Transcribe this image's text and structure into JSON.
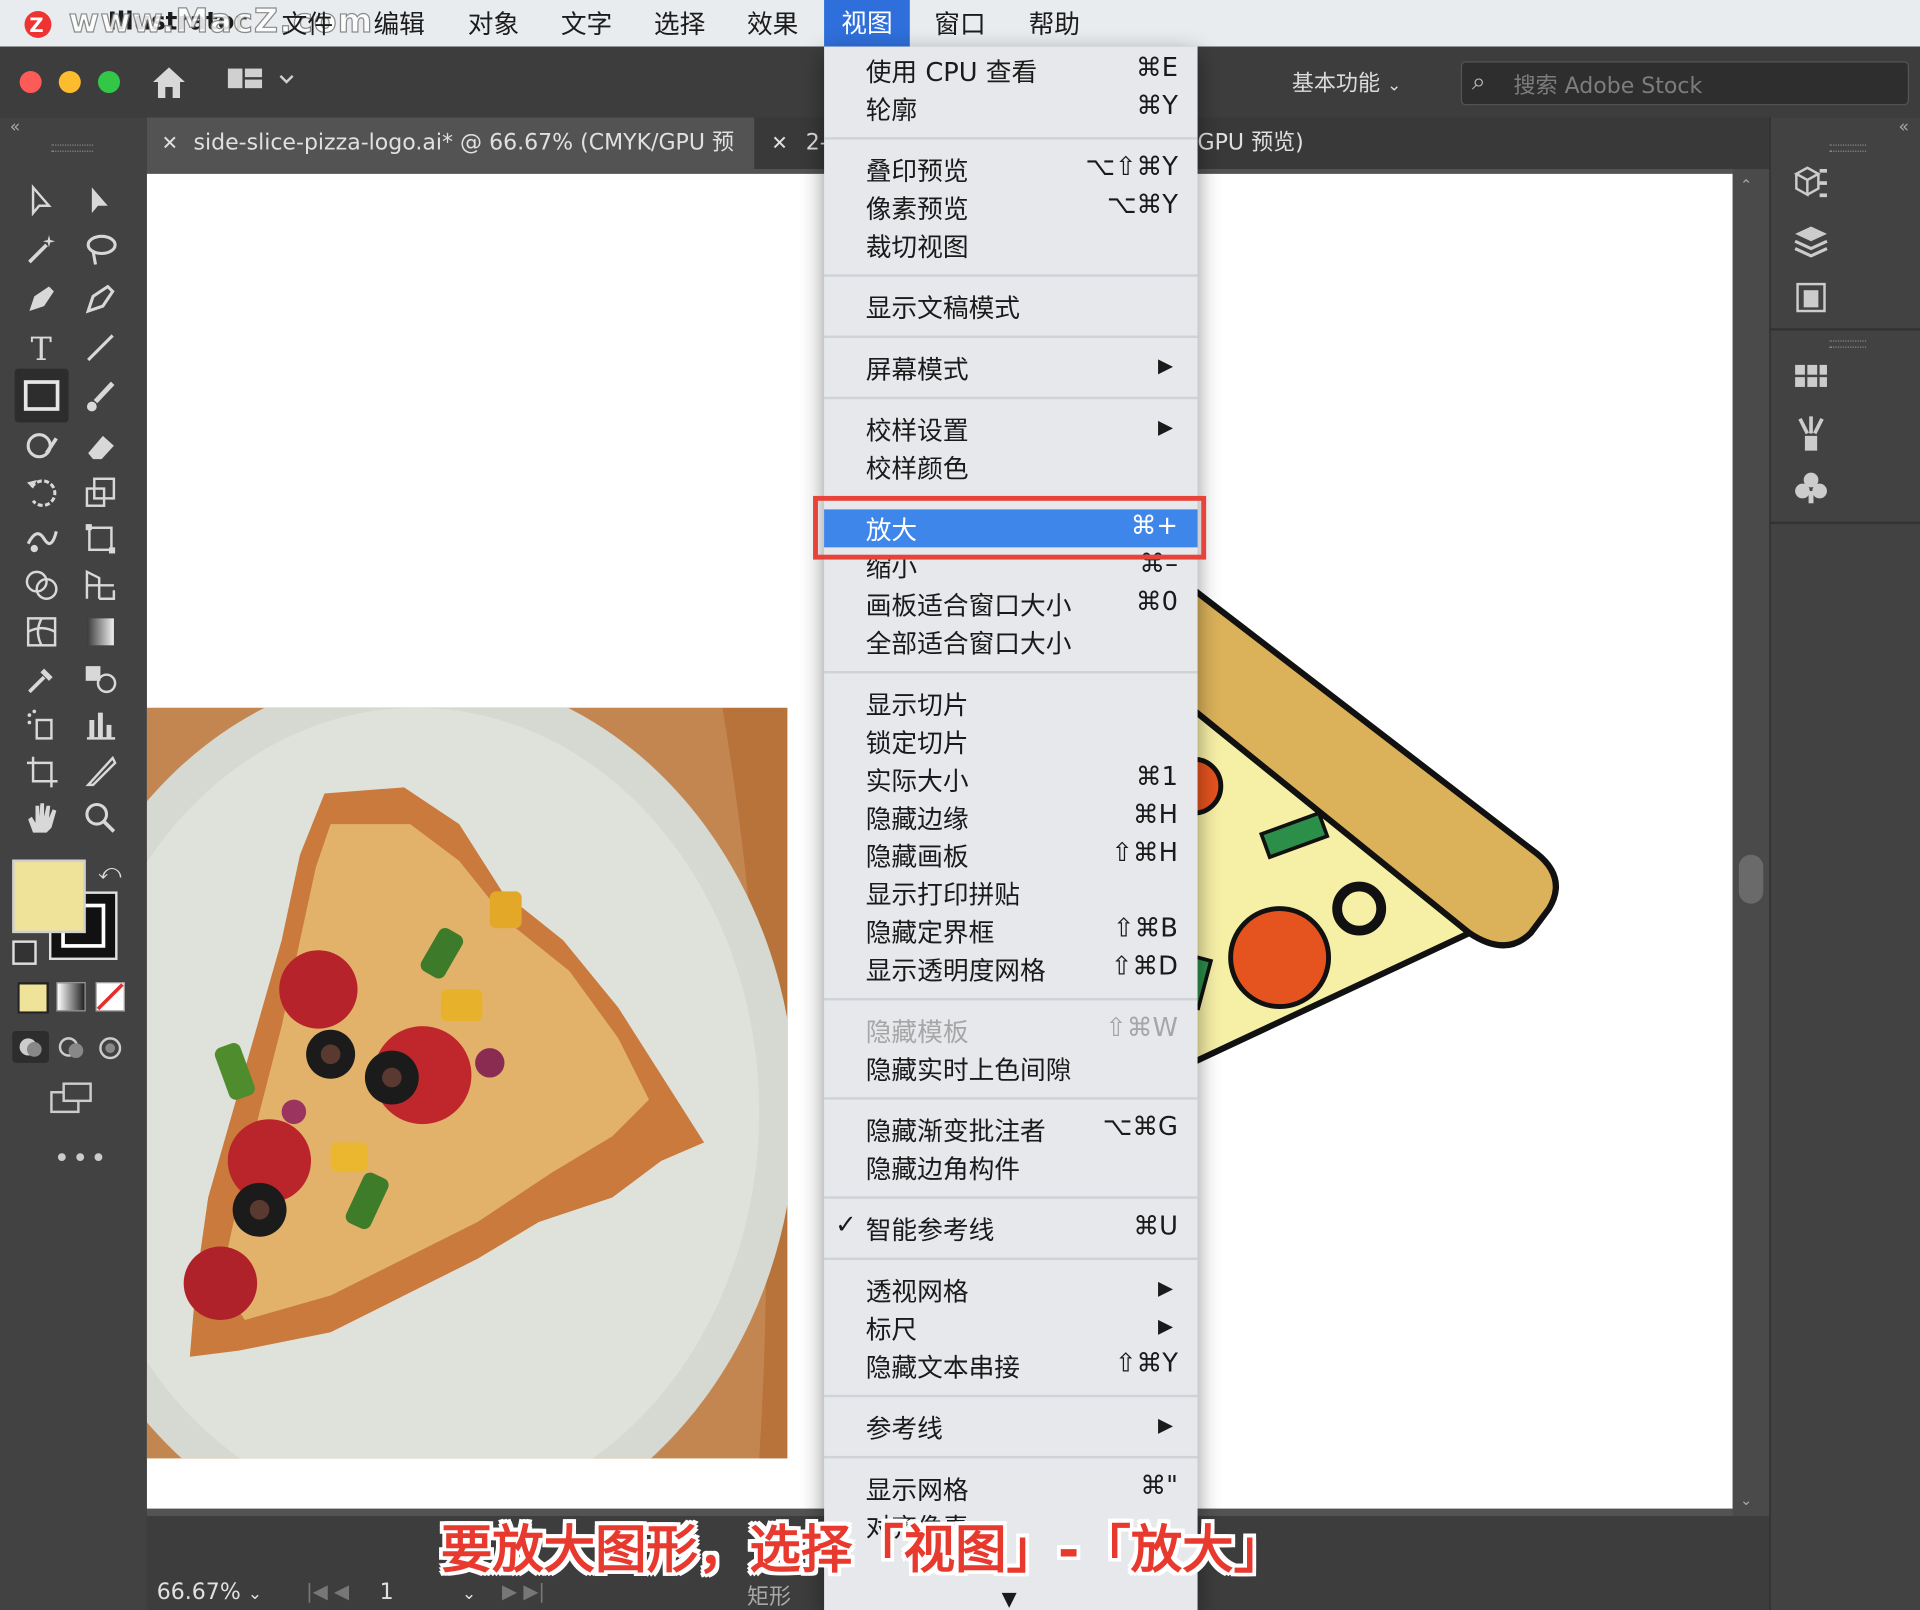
{
  "menubar": {
    "app": "Illustrator",
    "watermark": "www.MacZ.com",
    "items": [
      "文件",
      "编辑",
      "对象",
      "文字",
      "选择",
      "效果",
      "视图",
      "窗口",
      "帮助"
    ],
    "active_item": "视图"
  },
  "appbar": {
    "workspace": "基本功能",
    "search_placeholder": "搜索 Adobe Stock"
  },
  "tabs": [
    {
      "label": "side-slice-pizza-logo.ai* @ 66.67% (CMYK/GPU 预览)",
      "active": true
    },
    {
      "label": "2-",
      "active": false
    },
    {
      "label": "GPU 预览)",
      "active": false
    }
  ],
  "view_menu": {
    "items": [
      {
        "label": "使用 CPU 查看",
        "shortcut": "⌘E"
      },
      {
        "label": "轮廓",
        "shortcut": "⌘Y"
      },
      {
        "separator": true
      },
      {
        "label": "叠印预览",
        "shortcut": "⌥⇧⌘Y"
      },
      {
        "label": "像素预览",
        "shortcut": "⌥⌘Y"
      },
      {
        "label": "裁切视图",
        "shortcut": ""
      },
      {
        "separator": true
      },
      {
        "label": "显示文稿模式",
        "shortcut": ""
      },
      {
        "separator": true
      },
      {
        "label": "屏幕模式",
        "submenu": true
      },
      {
        "separator": true
      },
      {
        "label": "校样设置",
        "submenu": true
      },
      {
        "label": "校样颜色",
        "shortcut": ""
      },
      {
        "separator": true
      },
      {
        "label": "放大",
        "shortcut": "⌘+",
        "highlighted": true
      },
      {
        "label": "缩小",
        "shortcut": "⌘–"
      },
      {
        "label": "画板适合窗口大小",
        "shortcut": "⌘0"
      },
      {
        "label": "全部适合窗口大小",
        "shortcut": ""
      },
      {
        "separator": true
      },
      {
        "label": "显示切片",
        "shortcut": ""
      },
      {
        "label": "锁定切片",
        "shortcut": ""
      },
      {
        "label": "实际大小",
        "shortcut": "⌘1"
      },
      {
        "label": "隐藏边缘",
        "shortcut": "⌘H"
      },
      {
        "label": "隐藏画板",
        "shortcut": "⇧⌘H"
      },
      {
        "label": "显示打印拼贴",
        "shortcut": ""
      },
      {
        "label": "隐藏定界框",
        "shortcut": "⇧⌘B"
      },
      {
        "label": "显示透明度网格",
        "shortcut": "⇧⌘D"
      },
      {
        "separator": true
      },
      {
        "label": "隐藏模板",
        "shortcut": "⇧⌘W",
        "disabled": true
      },
      {
        "label": "隐藏实时上色间隙",
        "shortcut": ""
      },
      {
        "separator": true
      },
      {
        "label": "隐藏渐变批注者",
        "shortcut": "⌥⌘G"
      },
      {
        "label": "隐藏边角构件",
        "shortcut": ""
      },
      {
        "separator": true
      },
      {
        "label": "智能参考线",
        "shortcut": "⌘U",
        "checked": true
      },
      {
        "separator": true
      },
      {
        "label": "透视网格",
        "submenu": true
      },
      {
        "label": "标尺",
        "submenu": true
      },
      {
        "label": "隐藏文本串接",
        "shortcut": "⇧⌘Y"
      },
      {
        "separator": true
      },
      {
        "label": "参考线",
        "submenu": true
      },
      {
        "separator": true
      },
      {
        "label": "显示网格",
        "shortcut": "⌘\""
      },
      {
        "label": "对齐像素",
        "shortcut": ""
      }
    ]
  },
  "status": {
    "zoom": "66.67%",
    "page": "1",
    "tool": "矩形"
  },
  "caption": "要放大图形，选择「视图」-「放大」",
  "colors": {
    "fill_swatch": "#efe39a",
    "menu_highlight": "#3f86ea",
    "highlight_border": "#e8433a",
    "caption_red": "#e8392f"
  }
}
